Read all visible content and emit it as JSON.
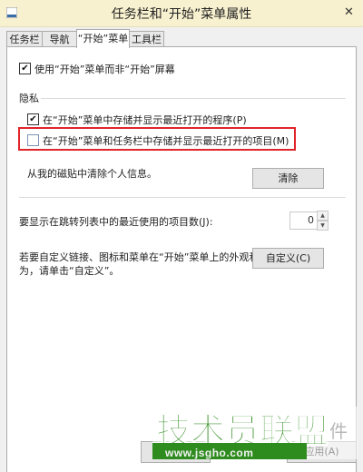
{
  "window": {
    "title": "任务栏和“开始”菜单属性",
    "close_glyph": "✕"
  },
  "tabs": [
    {
      "label": "任务栏",
      "active": false
    },
    {
      "label": "导航",
      "active": false
    },
    {
      "label": "“开始”菜单",
      "active": true
    },
    {
      "label": "工具栏",
      "active": false
    }
  ],
  "options": {
    "use_start_menu": {
      "label": "使用“开始”菜单而非“开始”屏幕",
      "checked": true
    }
  },
  "privacy": {
    "title": "隐私",
    "store_programs": {
      "label": "在“开始”菜单中存储并显示最近打开的程序(P)",
      "checked": true
    },
    "store_items": {
      "label": "在“开始”菜单和任务栏中存储并显示最近打开的项目(M)",
      "checked": false
    },
    "clear_text": "从我的磁贴中清除个人信息。",
    "clear_button": "清除"
  },
  "jumplist": {
    "label": "要显示在跳转列表中的最近使用的项目数(J):",
    "value": "0"
  },
  "customize": {
    "text_line1": "若要自定义链接、图标和菜单在“开始”菜单上的外观和行",
    "text_line2": "为，请单击“自定义”。",
    "button": "自定义(C)"
  },
  "footer": {
    "buttons": [
      "确定",
      "应用(A)"
    ]
  },
  "watermark": {
    "logo_text": "技术员联盟",
    "url": "www.jsgho.com"
  },
  "colors": {
    "highlight": "#e0252a",
    "watermark_green": "#2e8b1e"
  },
  "icons": {
    "checked": "✔",
    "spin_up": "▲",
    "spin_down": "▼"
  }
}
